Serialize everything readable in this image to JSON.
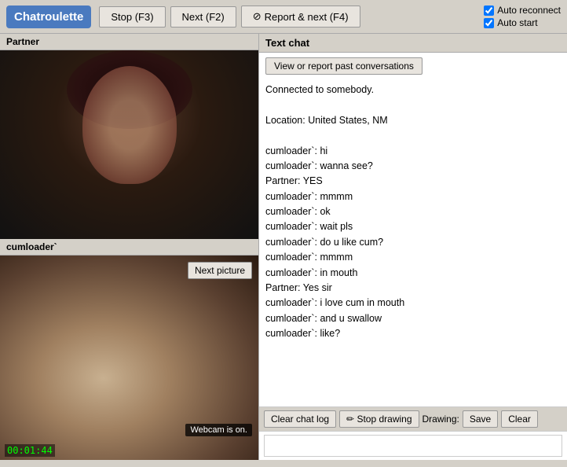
{
  "topbar": {
    "logo": "Chatroulette",
    "stop_label": "Stop (F3)",
    "next_label": "Next (F2)",
    "report_label": "Report & next (F4)",
    "auto_reconnect_label": "Auto reconnect",
    "auto_start_label": "Auto start",
    "auto_reconnect_checked": true,
    "auto_start_checked": true
  },
  "left": {
    "partner_label": "Partner",
    "local_label": "cumloader`",
    "next_picture_label": "Next picture",
    "webcam_on_label": "Webcam is on.",
    "timer": "00:01:44"
  },
  "chat": {
    "header": "Text chat",
    "view_report_label": "View or report past conversations",
    "messages": [
      "Connected to somebody.",
      "",
      "Location: United States, NM",
      "",
      "cumloader`: hi",
      "cumloader`: wanna see?",
      "Partner: YES",
      "cumloader`: mmmm",
      "cumloader`: ok",
      "cumloader`: wait pls",
      "cumloader`: do u like cum?",
      "cumloader`: mmmm",
      "cumloader`: in mouth",
      "Partner: Yes sir",
      "cumloader`: i love cum in mouth",
      "cumloader`: and u swallow",
      "cumloader`: like?"
    ],
    "clear_chat_label": "Clear chat log",
    "stop_drawing_label": "Stop drawing",
    "drawing_label": "Drawing:",
    "save_label": "Save",
    "clear_label": "Clear"
  }
}
